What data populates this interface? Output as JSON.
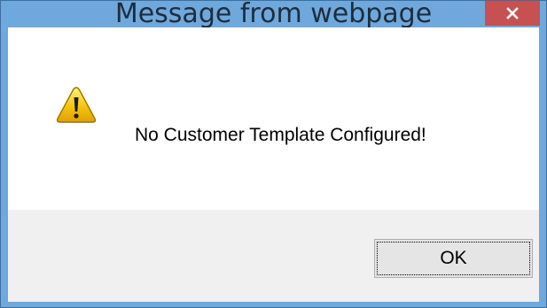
{
  "window": {
    "title": "Message from webpage",
    "close_icon": "close-icon",
    "titlebar_color": "#6fa8dc",
    "close_color": "#c75050"
  },
  "message": {
    "icon": "warning-icon",
    "text": "No Customer Template Configured!"
  },
  "buttons": {
    "ok_label": "OK"
  }
}
